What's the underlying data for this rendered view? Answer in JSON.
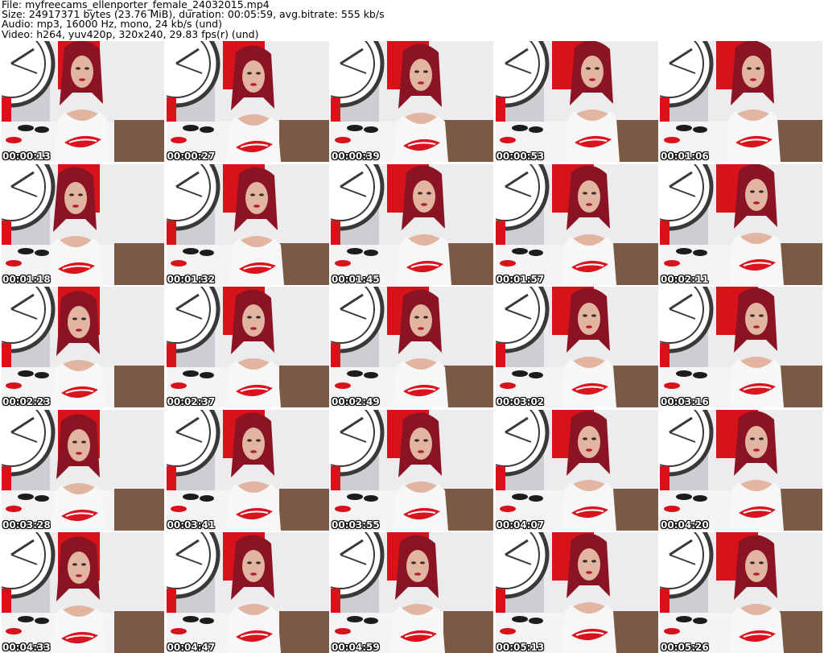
{
  "header": {
    "file_line": "File: myfreecams_ellenporter_female_24032015.mp4",
    "size_line": "Size: 24917371 bytes (23.76 MiB), duration: 00:05:59, avg.bitrate: 555 kb/s",
    "audio_line": "Audio: mp3, 16000 Hz, mono, 24 kb/s (und)",
    "video_line": "Video: h264, yuv420p, 320x240, 29.83 fps(r) (und)"
  },
  "frames": [
    {
      "timestamp": "00:00:13"
    },
    {
      "timestamp": "00:00:27"
    },
    {
      "timestamp": "00:00:39"
    },
    {
      "timestamp": "00:00:53"
    },
    {
      "timestamp": "00:01:06"
    },
    {
      "timestamp": "00:01:18"
    },
    {
      "timestamp": "00:01:32"
    },
    {
      "timestamp": "00:01:45"
    },
    {
      "timestamp": "00:01:57"
    },
    {
      "timestamp": "00:02:11"
    },
    {
      "timestamp": "00:02:23"
    },
    {
      "timestamp": "00:02:37"
    },
    {
      "timestamp": "00:02:49"
    },
    {
      "timestamp": "00:03:02"
    },
    {
      "timestamp": "00:03:16"
    },
    {
      "timestamp": "00:03:28"
    },
    {
      "timestamp": "00:03:41"
    },
    {
      "timestamp": "00:03:55"
    },
    {
      "timestamp": "00:04:07"
    },
    {
      "timestamp": "00:04:20"
    },
    {
      "timestamp": "00:04:33"
    },
    {
      "timestamp": "00:04:47"
    },
    {
      "timestamp": "00:04:59"
    },
    {
      "timestamp": "00:05:13"
    },
    {
      "timestamp": "00:05:26"
    }
  ],
  "colors": {
    "wall": "#ecebee",
    "red_panel": "#d8121b",
    "clock_dark": "#3b3838",
    "hair": "#8a1424",
    "skin": "#e2b5a0",
    "top": "#f7f7f8",
    "lips_print": "#d9141e",
    "floor": "#7a5a45",
    "bed": "#f4f4f6"
  }
}
